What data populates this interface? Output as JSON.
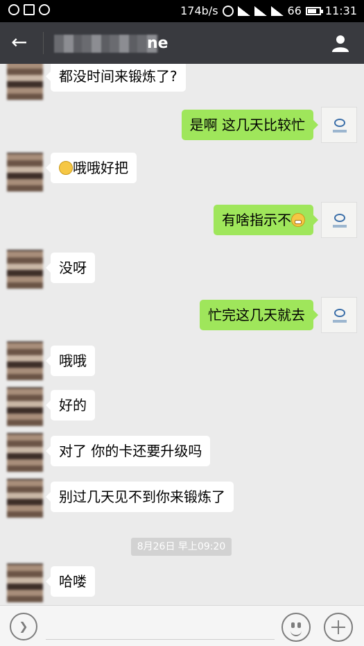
{
  "status_bar": {
    "network_speed": "174b/s",
    "battery_level": "66",
    "time": "11:31"
  },
  "header": {
    "title": "ne"
  },
  "messages": [
    {
      "side": "in",
      "text": "都没时间来锻炼了?"
    },
    {
      "side": "out",
      "text": "是啊 这几天比较忙"
    },
    {
      "side": "in",
      "text": "哦哦好把",
      "emoji": "confused-face-icon"
    },
    {
      "side": "out",
      "text": "有啥指示不",
      "emoji": "grinning-face-icon"
    },
    {
      "side": "in",
      "text": "没呀"
    },
    {
      "side": "out",
      "text": "忙完这几天就去"
    },
    {
      "side": "in",
      "text": "哦哦"
    },
    {
      "side": "in",
      "text": "好的"
    },
    {
      "side": "in",
      "text": "对了 你的卡还要升级吗"
    },
    {
      "side": "in",
      "text": "别过几天见不到你来锻炼了"
    },
    {
      "side": "in",
      "text": "哈喽"
    }
  ],
  "timestamp": "8月26日 早上09:20",
  "colors": {
    "outgoing_bubble": "#9fe65b",
    "incoming_bubble": "#ffffff",
    "title_bar": "#393a3f",
    "chat_background": "#ebebeb"
  }
}
